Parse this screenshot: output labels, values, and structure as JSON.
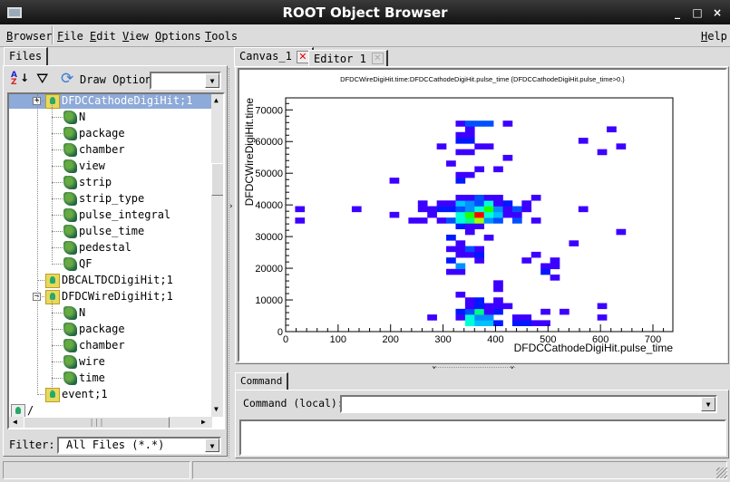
{
  "window": {
    "title": "ROOT Object Browser",
    "buttons": [
      "_",
      "□",
      "×"
    ]
  },
  "menu": {
    "items": [
      "Browser",
      "File",
      "Edit",
      "View",
      "Options",
      "Tools"
    ],
    "help": "Help"
  },
  "left": {
    "tab": "Files",
    "draw_option_label": "Draw Option:",
    "draw_option_value": "",
    "toolbar_icons": [
      "sort-az-icon",
      "filter-icon",
      "refresh-icon"
    ],
    "tree": [
      {
        "label": "DFDCCathodeDigiHit;1",
        "type": "tree",
        "expander": "+",
        "selected": true
      },
      {
        "label": "N",
        "type": "leaf"
      },
      {
        "label": "package",
        "type": "leaf"
      },
      {
        "label": "chamber",
        "type": "leaf"
      },
      {
        "label": "view",
        "type": "leaf"
      },
      {
        "label": "strip",
        "type": "leaf"
      },
      {
        "label": "strip_type",
        "type": "leaf"
      },
      {
        "label": "pulse_integral",
        "type": "leaf"
      },
      {
        "label": "pulse_time",
        "type": "leaf"
      },
      {
        "label": "pedestal",
        "type": "leaf"
      },
      {
        "label": "QF",
        "type": "leaf"
      },
      {
        "label": "DBCALTDCDigiHit;1",
        "type": "tree"
      },
      {
        "label": "DFDCWireDigiHit;1",
        "type": "tree",
        "expander": "−"
      },
      {
        "label": "N",
        "type": "leaf"
      },
      {
        "label": "package",
        "type": "leaf"
      },
      {
        "label": "chamber",
        "type": "leaf"
      },
      {
        "label": "wire",
        "type": "leaf"
      },
      {
        "label": "time",
        "type": "leaf"
      },
      {
        "label": "event;1",
        "type": "tree"
      },
      {
        "label": "/",
        "type": "folder"
      }
    ],
    "hscroll_grip": "|||",
    "filter_label": "Filter:",
    "filter_value": "All Files (*.*)"
  },
  "right": {
    "tabs": [
      {
        "label": "Canvas_1",
        "closable": true,
        "active": true
      },
      {
        "label": "Editor 1",
        "closable": true,
        "active": false
      }
    ],
    "command_tab": "Command",
    "command_label": "Command (local):",
    "command_value": ""
  },
  "chart_data": {
    "type": "heatmap",
    "title": "DFDCWireDigiHit.time:DFDCCathodeDigiHit.pulse_time {DFDCCathodeDigiHit.pulse_time>0.}",
    "xlabel": "DFDCCathodeDigiHit.pulse_time",
    "ylabel": "DFDCWireDigiHit.time",
    "xlim": [
      0,
      738
    ],
    "ylim": [
      0,
      73800
    ],
    "xticks": [
      "0",
      "100",
      "200",
      "300",
      "400",
      "500",
      "600",
      "700"
    ],
    "yticks": [
      "0",
      "10000",
      "20000",
      "30000",
      "40000",
      "50000",
      "60000",
      "70000"
    ],
    "bin_width": {
      "x": 18,
      "y": 1800
    },
    "palette": [
      "#3c00ff",
      "#0018ff",
      "#0050ff",
      "#0090ff",
      "#00c0ff",
      "#00ffd8",
      "#00ff80",
      "#20ff00",
      "#a8ff00",
      "#ff0000"
    ],
    "cells_format": [
      "x_low",
      "y_low",
      "count"
    ],
    "cells": [
      [
        342,
        1800,
        6
      ],
      [
        360,
        1800,
        5
      ],
      [
        378,
        1800,
        5
      ],
      [
        396,
        1800,
        2
      ],
      [
        432,
        1800,
        2
      ],
      [
        450,
        1800,
        2
      ],
      [
        468,
        1800,
        1
      ],
      [
        486,
        1800,
        1
      ],
      [
        270,
        3600,
        1
      ],
      [
        324,
        3600,
        1
      ],
      [
        342,
        3600,
        6
      ],
      [
        360,
        3600,
        4
      ],
      [
        378,
        3600,
        4
      ],
      [
        432,
        3600,
        1
      ],
      [
        450,
        3600,
        1
      ],
      [
        594,
        3600,
        1
      ],
      [
        324,
        5400,
        2
      ],
      [
        342,
        5400,
        3
      ],
      [
        360,
        5400,
        7
      ],
      [
        378,
        5400,
        1
      ],
      [
        396,
        5400,
        2
      ],
      [
        486,
        5400,
        1
      ],
      [
        522,
        5400,
        1
      ],
      [
        342,
        7200,
        1
      ],
      [
        360,
        7200,
        2
      ],
      [
        378,
        7200,
        1
      ],
      [
        396,
        7200,
        1
      ],
      [
        414,
        7200,
        1
      ],
      [
        594,
        7200,
        1
      ],
      [
        342,
        9000,
        1
      ],
      [
        360,
        9000,
        2
      ],
      [
        396,
        9000,
        1
      ],
      [
        324,
        10800,
        1
      ],
      [
        396,
        12600,
        1
      ],
      [
        396,
        14400,
        1
      ],
      [
        504,
        16200,
        1
      ],
      [
        306,
        18000,
        1
      ],
      [
        324,
        18000,
        1
      ],
      [
        486,
        18000,
        2
      ],
      [
        324,
        19800,
        4
      ],
      [
        486,
        19800,
        1
      ],
      [
        504,
        19800,
        1
      ],
      [
        306,
        21600,
        2
      ],
      [
        360,
        21600,
        1
      ],
      [
        450,
        21600,
        1
      ],
      [
        504,
        21600,
        1
      ],
      [
        324,
        23400,
        1
      ],
      [
        342,
        23400,
        1
      ],
      [
        360,
        23400,
        2
      ],
      [
        468,
        23400,
        1
      ],
      [
        306,
        25200,
        1
      ],
      [
        324,
        25200,
        1
      ],
      [
        342,
        25200,
        3
      ],
      [
        360,
        25200,
        1
      ],
      [
        324,
        27000,
        1
      ],
      [
        540,
        27000,
        1
      ],
      [
        306,
        28800,
        2
      ],
      [
        378,
        28800,
        1
      ],
      [
        342,
        30600,
        1
      ],
      [
        630,
        30600,
        1
      ],
      [
        324,
        32400,
        2
      ],
      [
        342,
        32400,
        1
      ],
      [
        360,
        32400,
        1
      ],
      [
        18,
        34200,
        1
      ],
      [
        234,
        34200,
        1
      ],
      [
        252,
        34200,
        1
      ],
      [
        288,
        34200,
        1
      ],
      [
        306,
        34200,
        3
      ],
      [
        324,
        34200,
        6
      ],
      [
        342,
        34200,
        7
      ],
      [
        360,
        34200,
        9
      ],
      [
        378,
        34200,
        4
      ],
      [
        396,
        34200,
        3
      ],
      [
        432,
        34200,
        3
      ],
      [
        468,
        34200,
        1
      ],
      [
        198,
        36000,
        1
      ],
      [
        270,
        36000,
        1
      ],
      [
        324,
        36000,
        6
      ],
      [
        342,
        36000,
        8
      ],
      [
        360,
        36000,
        10
      ],
      [
        378,
        36000,
        6
      ],
      [
        396,
        36000,
        5
      ],
      [
        414,
        36000,
        1
      ],
      [
        432,
        36000,
        1
      ],
      [
        18,
        37800,
        1
      ],
      [
        126,
        37800,
        1
      ],
      [
        252,
        37800,
        1
      ],
      [
        270,
        37800,
        1
      ],
      [
        288,
        37800,
        2
      ],
      [
        306,
        37800,
        2
      ],
      [
        324,
        37800,
        3
      ],
      [
        342,
        37800,
        4
      ],
      [
        360,
        37800,
        6
      ],
      [
        378,
        37800,
        8
      ],
      [
        396,
        37800,
        4
      ],
      [
        414,
        37800,
        1
      ],
      [
        432,
        37800,
        3
      ],
      [
        450,
        37800,
        1
      ],
      [
        558,
        37800,
        1
      ],
      [
        252,
        39600,
        1
      ],
      [
        288,
        39600,
        1
      ],
      [
        306,
        39600,
        1
      ],
      [
        324,
        39600,
        5
      ],
      [
        342,
        39600,
        4
      ],
      [
        360,
        39600,
        3
      ],
      [
        378,
        39600,
        6
      ],
      [
        396,
        39600,
        1
      ],
      [
        414,
        39600,
        2
      ],
      [
        450,
        39600,
        1
      ],
      [
        324,
        41400,
        1
      ],
      [
        342,
        41400,
        1
      ],
      [
        360,
        41400,
        3
      ],
      [
        378,
        41400,
        1
      ],
      [
        396,
        41400,
        1
      ],
      [
        468,
        41400,
        1
      ],
      [
        198,
        46800,
        1
      ],
      [
        324,
        46800,
        2
      ],
      [
        324,
        48600,
        1
      ],
      [
        342,
        48600,
        1
      ],
      [
        360,
        50400,
        1
      ],
      [
        396,
        50400,
        1
      ],
      [
        306,
        52200,
        1
      ],
      [
        414,
        54000,
        1
      ],
      [
        324,
        55800,
        1
      ],
      [
        342,
        55800,
        1
      ],
      [
        594,
        55800,
        1
      ],
      [
        288,
        57600,
        1
      ],
      [
        360,
        57600,
        1
      ],
      [
        378,
        57600,
        1
      ],
      [
        630,
        57600,
        1
      ],
      [
        324,
        59400,
        2
      ],
      [
        342,
        59400,
        2
      ],
      [
        558,
        59400,
        1
      ],
      [
        324,
        61200,
        1
      ],
      [
        342,
        61200,
        1
      ],
      [
        342,
        63000,
        1
      ],
      [
        612,
        63000,
        1
      ],
      [
        324,
        64800,
        1
      ],
      [
        342,
        64800,
        3
      ],
      [
        360,
        64800,
        3
      ],
      [
        378,
        64800,
        3
      ],
      [
        414,
        64800,
        1
      ]
    ]
  }
}
